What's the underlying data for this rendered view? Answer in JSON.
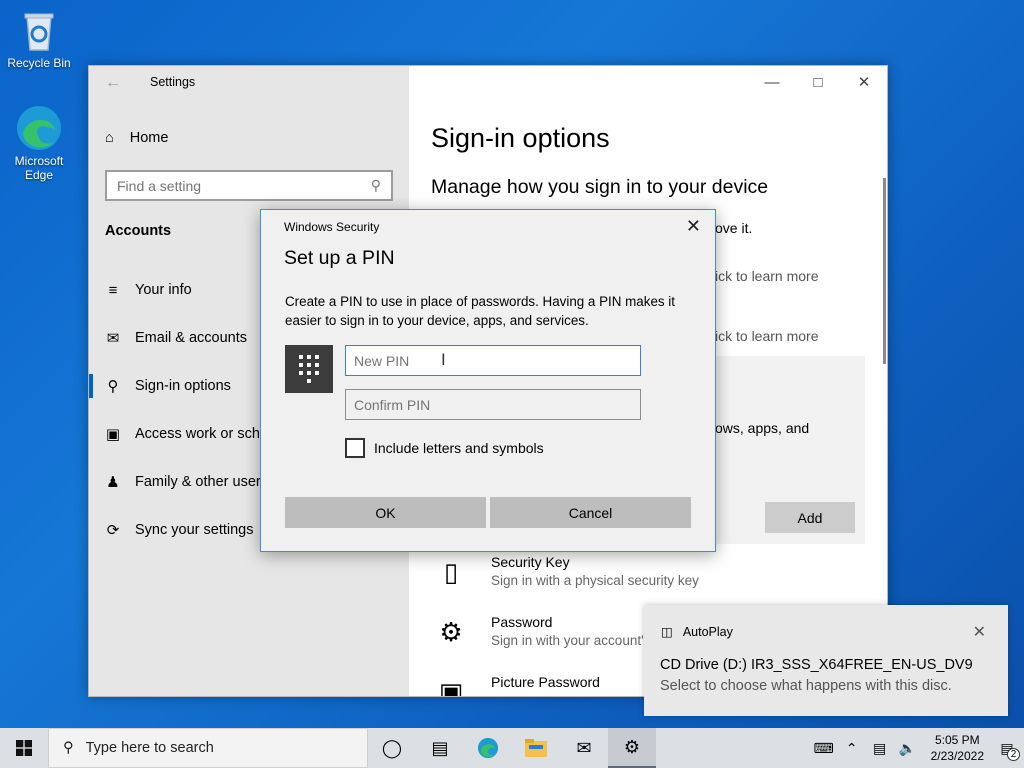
{
  "desktop": {
    "icons": [
      {
        "label": "Recycle Bin"
      },
      {
        "label": "Microsoft Edge"
      }
    ]
  },
  "settings": {
    "title": "Settings",
    "home": "Home",
    "search_placeholder": "Find a setting",
    "section": "Accounts",
    "nav": [
      {
        "label": "Your info",
        "icon": "person-list-icon"
      },
      {
        "label": "Email & accounts",
        "icon": "mail-icon"
      },
      {
        "label": "Sign-in options",
        "icon": "key-icon"
      },
      {
        "label": "Access work or scho",
        "icon": "briefcase-icon"
      },
      {
        "label": "Family & other users",
        "icon": "people-icon"
      },
      {
        "label": "Sync your settings",
        "icon": "sync-icon"
      }
    ],
    "page_title": "Sign-in options",
    "subtitle": "Manage how you sign in to your device",
    "fragments": {
      "f1": "ove it.",
      "f2": "ick to learn more",
      "f3": "ick to learn more",
      "f4": "ows, apps, and"
    },
    "add_label": "Add",
    "options": [
      {
        "title": "Security Key",
        "desc": "Sign in with a physical security key"
      },
      {
        "title": "Password",
        "desc": "Sign in with your account's"
      },
      {
        "title": "Picture Password",
        "desc": ""
      }
    ]
  },
  "dialog": {
    "caption": "Windows Security",
    "title": "Set up a PIN",
    "description": "Create a PIN to use in place of passwords. Having a PIN makes it easier to sign in to your device, apps, and services.",
    "new_pin_placeholder": "New PIN",
    "confirm_pin_placeholder": "Confirm PIN",
    "checkbox_label": "Include letters and symbols",
    "ok_label": "OK",
    "cancel_label": "Cancel"
  },
  "toast": {
    "app": "AutoPlay",
    "title": "CD Drive (D:) IR3_SSS_X64FREE_EN-US_DV9",
    "body": "Select to choose what happens with this disc."
  },
  "taskbar": {
    "search_placeholder": "Type here to search",
    "time": "5:05 PM",
    "date": "2/23/2022",
    "notification_count": "2"
  },
  "colors": {
    "accent": "#0067c0",
    "desktop": "#1677d6"
  }
}
